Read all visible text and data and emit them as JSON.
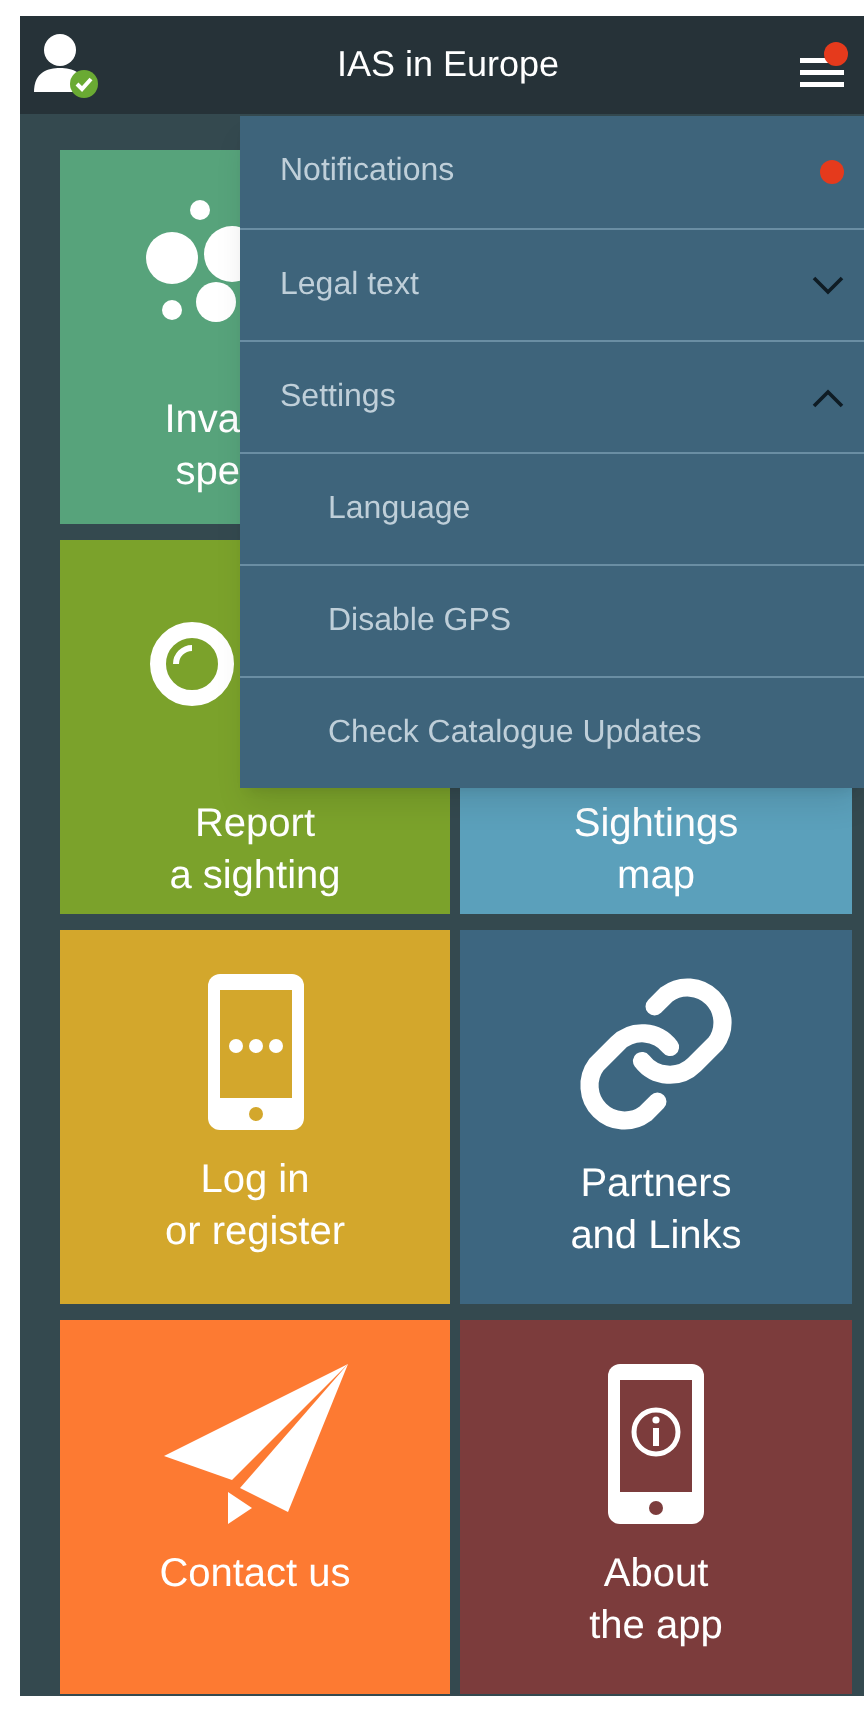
{
  "header": {
    "title": "IAS in Europe",
    "user_verified": true,
    "menu_badge": true
  },
  "tiles": [
    {
      "lines": [
        "Inva",
        "spe"
      ],
      "kind": "species"
    },
    {
      "lines": [
        "Report",
        "a sighting"
      ],
      "kind": "report"
    },
    {
      "lines": [
        "Sightings",
        "map"
      ],
      "kind": "map"
    },
    {
      "lines": [
        "Log in",
        "or register"
      ],
      "kind": "login"
    },
    {
      "lines": [
        "Partners",
        "and Links"
      ],
      "kind": "partners"
    },
    {
      "lines": [
        "Contact us"
      ],
      "kind": "contact"
    },
    {
      "lines": [
        "About",
        "the app"
      ],
      "kind": "about"
    }
  ],
  "menu": {
    "items": [
      {
        "label": "Notifications",
        "kind": "notice",
        "unread": true
      },
      {
        "label": "Legal text",
        "kind": "group",
        "expanded": false
      },
      {
        "label": "Settings",
        "kind": "group",
        "expanded": true,
        "children": [
          {
            "label": "Language"
          },
          {
            "label": "Disable GPS"
          },
          {
            "label": "Check Catalogue Updates"
          }
        ]
      }
    ]
  }
}
